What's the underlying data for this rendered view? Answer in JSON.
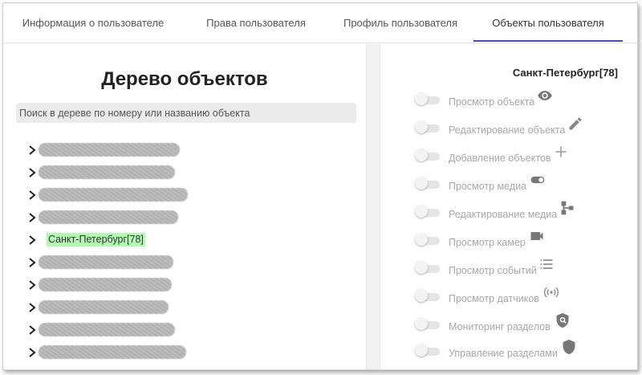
{
  "tabs": [
    {
      "label": "Информация о пользователе"
    },
    {
      "label": "Права пользователя"
    },
    {
      "label": "Профиль пользователя"
    },
    {
      "label": "Объекты пользователя",
      "active": true
    }
  ],
  "tree_panel": {
    "title": "Дерево объектов",
    "search_placeholder": "Поиск в дереве по номеру или названию объекта",
    "rows": [
      {
        "label": null,
        "redacted": true
      },
      {
        "label": null,
        "redacted": true
      },
      {
        "label": null,
        "redacted": true
      },
      {
        "label": null,
        "redacted": true
      },
      {
        "label": "Санкт-Петербург[78]",
        "highlighted": true
      },
      {
        "label": null,
        "redacted": true
      },
      {
        "label": null,
        "redacted": true
      },
      {
        "label": null,
        "redacted": true
      },
      {
        "label": null,
        "redacted": true
      },
      {
        "label": null,
        "redacted": true
      }
    ]
  },
  "object_panel": {
    "title": "Санкт-Петербург[78]",
    "permissions": [
      {
        "label": "Просмотр объекта",
        "icon": "eye-icon",
        "enabled": false
      },
      {
        "label": "Редактирование объекта",
        "icon": "pencil-icon",
        "enabled": false
      },
      {
        "label": "Добавление объектов",
        "icon": "plus-icon",
        "enabled": false
      },
      {
        "label": "Просмотр медиа",
        "icon": "toggle-icon",
        "enabled": false
      },
      {
        "label": "Редактирование медиа",
        "icon": "hierarchy-icon",
        "enabled": false
      },
      {
        "label": "Просмотр камер",
        "icon": "camera-icon",
        "enabled": false
      },
      {
        "label": "Просмотр событий",
        "icon": "list-icon",
        "enabled": false
      },
      {
        "label": "Просмотр датчиков",
        "icon": "sensor-icon",
        "enabled": false
      },
      {
        "label": "Мониторинг разделов",
        "icon": "shield-search-icon",
        "enabled": false
      },
      {
        "label": "Управление разделами",
        "icon": "shield-icon",
        "enabled": false
      }
    ]
  },
  "colors": {
    "tab_indicator": "#3f51b5",
    "highlight": "#b6f7b6",
    "disabled_text": "#a8a8a8"
  }
}
